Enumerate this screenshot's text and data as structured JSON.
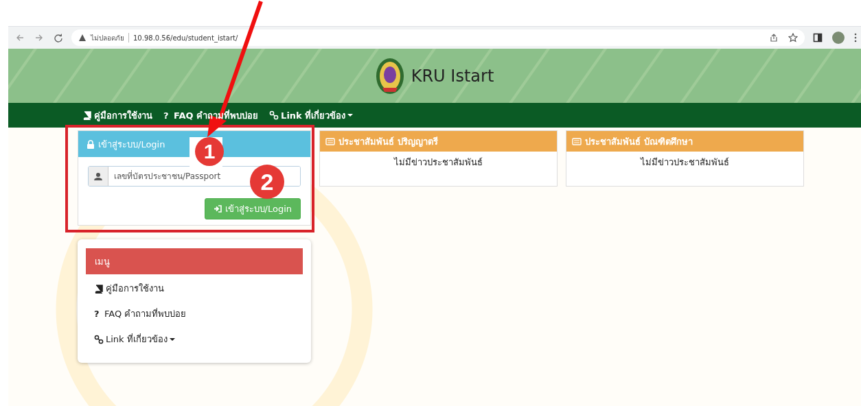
{
  "browser": {
    "security_label": "ไม่ปลอดภัย",
    "url": "10.98.0.56/edu/student_istart/"
  },
  "header": {
    "title": "KRU Istart"
  },
  "nav": [
    {
      "kind": "manual",
      "label": "คู่มือการใช้งาน"
    },
    {
      "kind": "help",
      "symbol": "?",
      "label": "FAQ คำถามที่พบบ่อย"
    },
    {
      "kind": "links",
      "label": "Link ที่เกี่ยวข้อง"
    }
  ],
  "login": {
    "title": "เข้าสู่ระบบ/Login",
    "placeholder": "เลขที่บัตรประชาชน/Passport",
    "button": "เข้าสู่ระบบ/Login"
  },
  "news": [
    {
      "title": "ประชาสัมพันธ์ ปริญญาตรี",
      "message": "ไม่มีข่าวประชาสัมพันธ์"
    },
    {
      "title": "ประชาสัมพันธ์ บัณฑิตศึกษา",
      "message": "ไม่มีข่าวประชาสัมพันธ์"
    }
  ],
  "menu": {
    "title": "เมนู",
    "items": [
      {
        "kind": "manual",
        "label": "คู่มือการใช้งาน"
      },
      {
        "kind": "help",
        "symbol": "?",
        "label": "FAQ คำถามที่พบบ่อย"
      },
      {
        "kind": "links",
        "label": "Link ที่เกี่ยวข้อง"
      }
    ]
  },
  "annotations": {
    "markers": [
      "1",
      "2"
    ]
  }
}
